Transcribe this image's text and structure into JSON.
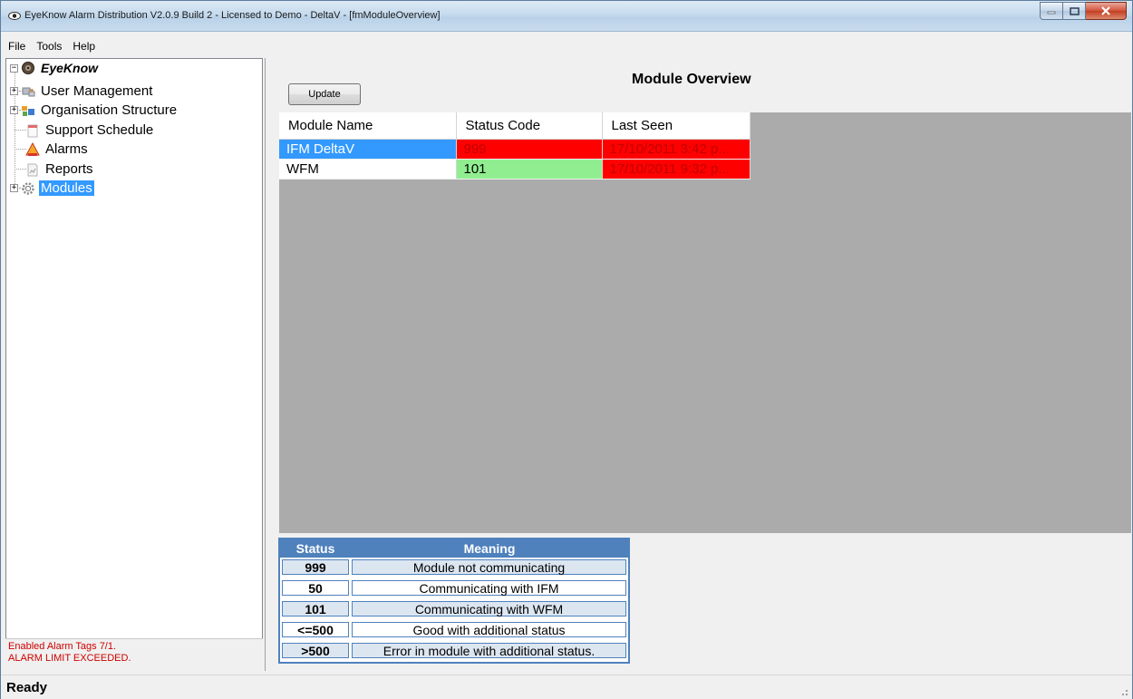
{
  "window": {
    "title": "EyeKnow Alarm Distribution V2.0.9 Build 2 - Licensed to Demo - DeltaV - [fmModuleOverview]"
  },
  "menu": [
    "File",
    "Tools",
    "Help"
  ],
  "tree": {
    "root": "EyeKnow",
    "items": [
      {
        "label": "User Management",
        "icon": "users-icon",
        "expandable": true
      },
      {
        "label": "Organisation Structure",
        "icon": "org-chart-icon",
        "expandable": true
      },
      {
        "label": "Support Schedule",
        "icon": "calendar-icon",
        "expandable": false
      },
      {
        "label": "Alarms",
        "icon": "alarm-bell-icon",
        "expandable": false
      },
      {
        "label": "Reports",
        "icon": "report-icon",
        "expandable": false
      },
      {
        "label": "Modules",
        "icon": "gear-icon",
        "expandable": true,
        "selected": true
      }
    ]
  },
  "alarm_status": {
    "line1": "Enabled Alarm Tags 7/1.",
    "line2": "ALARM LIMIT EXCEEDED."
  },
  "main": {
    "title": "Module Overview",
    "update_label": "Update",
    "grid": {
      "columns": [
        "Module Name",
        "Status Code",
        "Last Seen"
      ],
      "rows": [
        {
          "name": "IFM DeltaV",
          "code": "999",
          "last_seen": "17/10/2011 3:42 p...",
          "selected": true,
          "code_color": "#ff0000",
          "seen_color": "#ff0000"
        },
        {
          "name": "WFM",
          "code": "101",
          "last_seen": "17/10/2011 9:32 p...",
          "selected": false,
          "code_color": "#90ee90",
          "seen_color": "#ff0000"
        }
      ]
    },
    "legend": {
      "headers": [
        "Status",
        "Meaning"
      ],
      "rows": [
        {
          "status": "999",
          "meaning": "Module not communicating"
        },
        {
          "status": "50",
          "meaning": "Communicating with IFM"
        },
        {
          "status": "101",
          "meaning": "Communicating with WFM"
        },
        {
          "status": "<=500",
          "meaning": "Good with additional status"
        },
        {
          "status": ">500",
          "meaning": "Error in module with additional status."
        }
      ]
    }
  },
  "statusbar": {
    "text": "Ready"
  },
  "colors": {
    "selection": "#3399ff",
    "legend_header": "#4f81bd",
    "status_red": "#ff0000",
    "status_green": "#90ee90",
    "alarm_text": "#d00000"
  }
}
